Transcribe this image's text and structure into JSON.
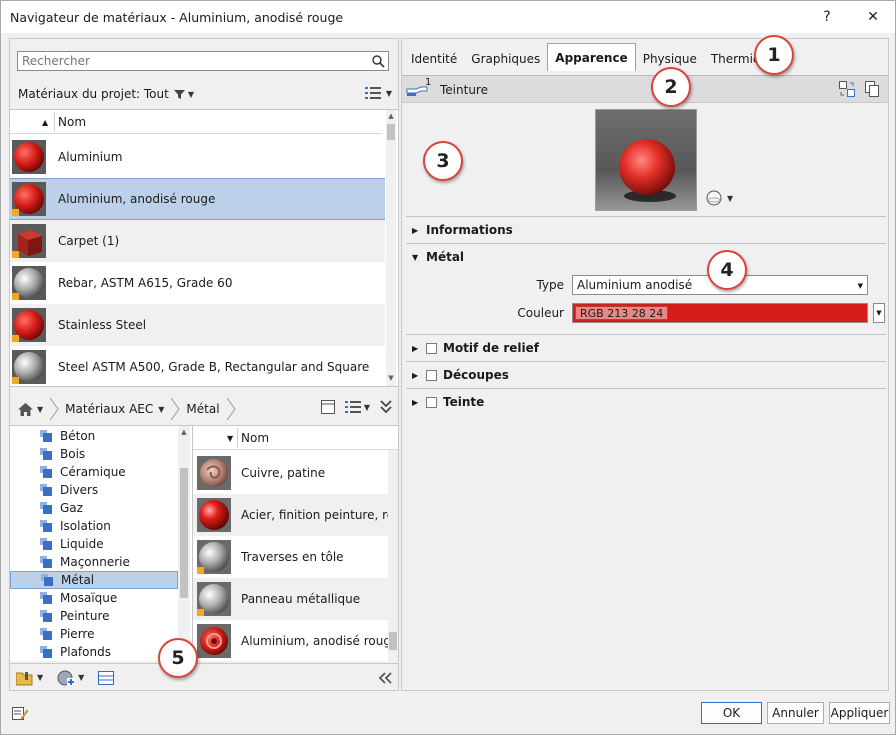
{
  "window": {
    "title": "Navigateur de matériaux - Aluminium, anodisé rouge",
    "help": "?",
    "close": "✕"
  },
  "search": {
    "placeholder": "Rechercher"
  },
  "project": {
    "filter_label": "Matériaux du projet: Tout",
    "column_name": "Nom",
    "items": [
      {
        "label": "Aluminium"
      },
      {
        "label": "Aluminium, anodisé rouge"
      },
      {
        "label": "Carpet (1)"
      },
      {
        "label": "Rebar, ASTM A615, Grade 60"
      },
      {
        "label": "Stainless Steel"
      },
      {
        "label": "Steel ASTM A500, Grade B, Rectangular and Square"
      }
    ]
  },
  "library": {
    "breadcrumb": [
      "Matériaux AEC",
      "Métal"
    ],
    "categories": [
      "Béton",
      "Bois",
      "Céramique",
      "Divers",
      "Gaz",
      "Isolation",
      "Liquide",
      "Maçonnerie",
      "Métal",
      "Mosaïque",
      "Peinture",
      "Pierre",
      "Plafonds"
    ],
    "selected_category": "Métal",
    "column_name": "Nom",
    "assets": [
      {
        "label": "Cuivre, patine"
      },
      {
        "label": "Acier, finition peinture, rouge"
      },
      {
        "label": "Traverses en tôle"
      },
      {
        "label": "Panneau métallique"
      },
      {
        "label": "Aluminium, anodisé rouge"
      }
    ]
  },
  "tabs": [
    "Identité",
    "Graphiques",
    "Apparence",
    "Physique",
    "Thermique"
  ],
  "active_tab": "Apparence",
  "asset": {
    "count": "1",
    "name": "Teinture"
  },
  "sections": {
    "info": "Informations",
    "metal": "Métal",
    "relief": "Motif de relief",
    "cutouts": "Découpes",
    "tint": "Teinte"
  },
  "props": {
    "type_label": "Type",
    "type_value": "Aluminium anodisé",
    "color_label": "Couleur",
    "color_value": "RGB 213 28 24",
    "color_hex": "#d51c18"
  },
  "callouts": [
    "1",
    "2",
    "3",
    "4",
    "5"
  ],
  "buttons": {
    "ok": "OK",
    "cancel": "Annuler",
    "apply": "Appliquer"
  },
  "colors": {
    "accent": "#d9453a",
    "selection": "#bcd0ea",
    "folder": "#3b6fc4"
  }
}
